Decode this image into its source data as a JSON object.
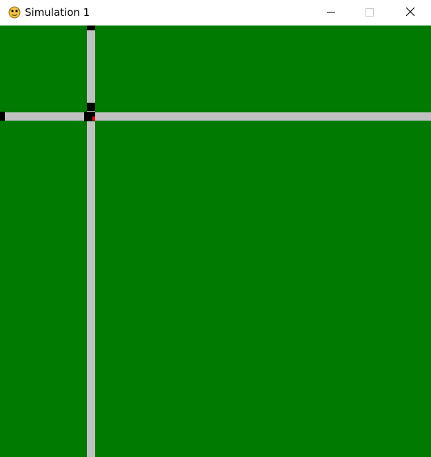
{
  "window": {
    "title": "Simulation 1",
    "app_icon": "python-snake-icon",
    "controls": {
      "minimize_icon": "minimize-icon",
      "maximize_icon": "maximize-icon",
      "close_icon": "close-icon"
    }
  },
  "simulation": {
    "colors": {
      "background": "#007a00",
      "road": "#c0c0c0",
      "vehicle_block": "#000000",
      "signal": "#ff0000"
    }
  }
}
